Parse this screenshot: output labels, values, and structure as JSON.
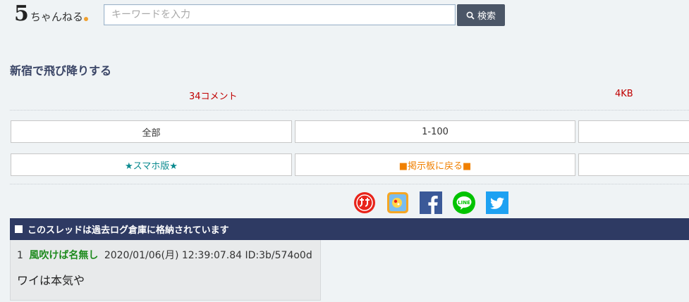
{
  "header": {
    "logo": {
      "five": "5",
      "rest": "ちゃんねる"
    },
    "search": {
      "placeholder": "キーワードを入力",
      "button_label": "検索"
    }
  },
  "thread": {
    "title": "新宿で飛び降りする",
    "comments": "34コメント",
    "size": "4KB"
  },
  "nav": {
    "row1": [
      "全部",
      "1-100",
      ""
    ],
    "row2": [
      "★スマホ版★",
      "■掲示板に戻る■",
      ""
    ]
  },
  "share": {
    "icons": [
      "matome-icon",
      "chrome-extension-icon",
      "facebook-icon",
      "line-icon",
      "twitter-icon"
    ],
    "colors": {
      "facebook": "#3b5998",
      "line": "#00c300",
      "twitter": "#1da1f2",
      "matome": "#e8231a"
    }
  },
  "archive_notice": "このスレッドは過去ログ倉庫に格納されています",
  "posts": [
    {
      "number": "1",
      "name": "風吹けば名無し",
      "datetime": "2020/01/06(月) 12:39:07.84",
      "id": "ID:3b/574o0d",
      "body": "ワイは本気や"
    }
  ]
}
